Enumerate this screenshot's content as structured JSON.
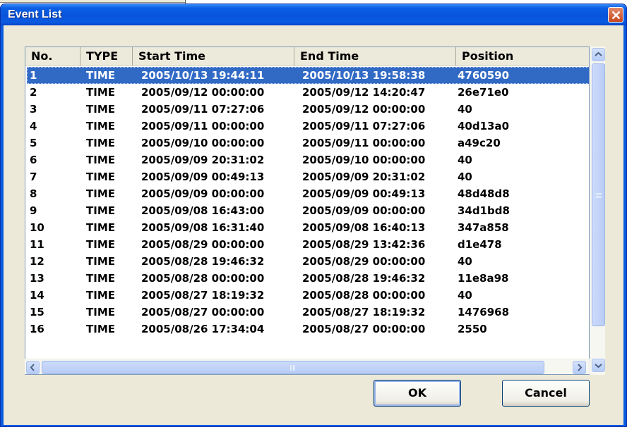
{
  "dialog": {
    "title": "Event List",
    "ok_label": "OK",
    "cancel_label": "Cancel"
  },
  "columns": [
    "No.",
    "TYPE",
    "Start Time",
    "End Time",
    "Position"
  ],
  "rows": [
    {
      "no": "1",
      "type": "TIME",
      "start": "2005/10/13 19:44:11",
      "end": "2005/10/13 19:58:38",
      "position": "4760590",
      "selected": true
    },
    {
      "no": "2",
      "type": "TIME",
      "start": "2005/09/12 00:00:00",
      "end": "2005/09/12 14:20:47",
      "position": "26e71e0"
    },
    {
      "no": "3",
      "type": "TIME",
      "start": "2005/09/11 07:27:06",
      "end": "2005/09/12 00:00:00",
      "position": "40"
    },
    {
      "no": "4",
      "type": "TIME",
      "start": "2005/09/11 00:00:00",
      "end": "2005/09/11 07:27:06",
      "position": "40d13a0"
    },
    {
      "no": "5",
      "type": "TIME",
      "start": "2005/09/10 00:00:00",
      "end": "2005/09/11 00:00:00",
      "position": "a49c20"
    },
    {
      "no": "6",
      "type": "TIME",
      "start": "2005/09/09 20:31:02",
      "end": "2005/09/10 00:00:00",
      "position": "40"
    },
    {
      "no": "7",
      "type": "TIME",
      "start": "2005/09/09 00:49:13",
      "end": "2005/09/09 20:31:02",
      "position": "40"
    },
    {
      "no": "8",
      "type": "TIME",
      "start": "2005/09/09 00:00:00",
      "end": "2005/09/09 00:49:13",
      "position": "48d48d8"
    },
    {
      "no": "9",
      "type": "TIME",
      "start": "2005/09/08 16:43:00",
      "end": "2005/09/09 00:00:00",
      "position": "34d1bd8"
    },
    {
      "no": "10",
      "type": "TIME",
      "start": "2005/09/08 16:31:40",
      "end": "2005/09/08 16:40:13",
      "position": "347a858"
    },
    {
      "no": "11",
      "type": "TIME",
      "start": "2005/08/29 00:00:00",
      "end": "2005/08/29 13:42:36",
      "position": "d1e478"
    },
    {
      "no": "12",
      "type": "TIME",
      "start": "2005/08/28 19:46:32",
      "end": "2005/08/29 00:00:00",
      "position": "40"
    },
    {
      "no": "13",
      "type": "TIME",
      "start": "2005/08/28 00:00:00",
      "end": "2005/08/28 19:46:32",
      "position": "11e8a98"
    },
    {
      "no": "14",
      "type": "TIME",
      "start": "2005/08/27 18:19:32",
      "end": "2005/08/28 00:00:00",
      "position": "40"
    },
    {
      "no": "15",
      "type": "TIME",
      "start": "2005/08/27 00:00:00",
      "end": "2005/08/27 18:19:32",
      "position": "1476968"
    },
    {
      "no": "16",
      "type": "TIME",
      "start": "2005/08/26 17:34:04",
      "end": "2005/08/27 00:00:00",
      "position": "2550"
    }
  ],
  "icons": {
    "close": "close-x-icon",
    "scroll_up": "chevron-up-icon",
    "scroll_down": "chevron-down-icon",
    "scroll_left": "chevron-left-icon",
    "scroll_right": "chevron-right-icon"
  },
  "colors": {
    "titlebar": "#0a5ae0",
    "selection": "#316ac5",
    "dialog_bg": "#ece9d8",
    "close_button": "#c8461f"
  }
}
